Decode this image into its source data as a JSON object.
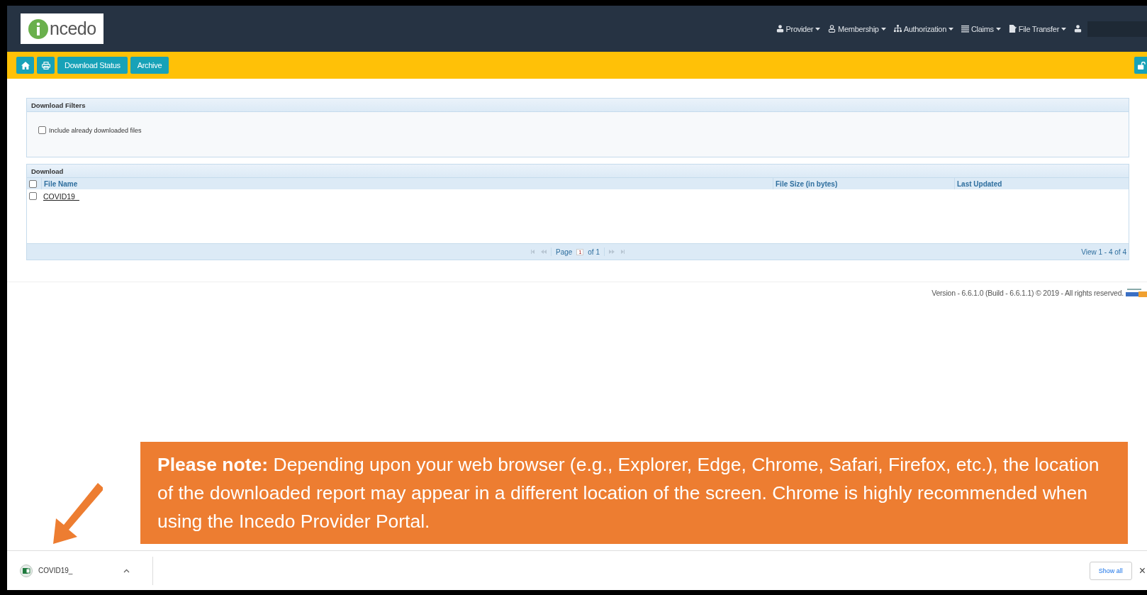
{
  "header": {
    "logo_text": "ncedo",
    "menus": [
      {
        "label": "Provider",
        "kind": "person"
      },
      {
        "label": "Membership",
        "kind": "member"
      },
      {
        "label": "Authorization",
        "kind": "hierarchy"
      },
      {
        "label": "Claims",
        "kind": "list"
      },
      {
        "label": "File Transfer",
        "kind": "file"
      }
    ]
  },
  "toolbar": {
    "buttons": [
      {
        "kind": "home"
      },
      {
        "kind": "print"
      },
      {
        "kind": "text",
        "label": "Download Status"
      },
      {
        "kind": "text",
        "label": "Archive"
      }
    ]
  },
  "filters": {
    "title": "Download Filters",
    "option": {
      "label": "Include already downloaded files",
      "checked": false
    }
  },
  "download": {
    "title": "Download",
    "select_all_checked": false,
    "columns": [
      "File Name",
      "File Size (in bytes)",
      "Last Updated"
    ],
    "rows": [
      {
        "file_name": "COVID19_",
        "checked": false
      }
    ],
    "pager": {
      "page_label": "Page",
      "page": "1",
      "of": "of 1",
      "view": "View 1 - 4 of 4"
    }
  },
  "footer": {
    "version": "Version - 6.6.1.0 (Build - 6.6.1.1) © 2019 - All rights reserved."
  },
  "note": "**Please note:** Depending upon your web browser (e.g., Explorer, Edge, Chrome, Safari, Firefox, etc.), the location of the downloaded report may appear in a different location of the screen. Chrome is highly recommended when using the Incedo Provider Portal.",
  "download_bar": {
    "file": "COVID19_",
    "show_all": "Show all",
    "close": "×"
  }
}
